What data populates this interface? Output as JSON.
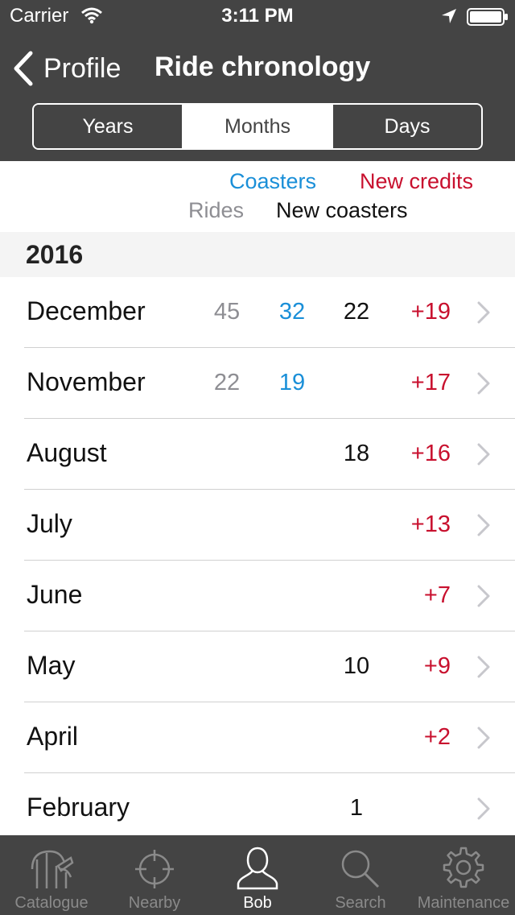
{
  "status_bar": {
    "carrier": "Carrier",
    "time": "3:11 PM"
  },
  "nav": {
    "back_label": "Profile",
    "title": "Ride chronology"
  },
  "segments": [
    {
      "label": "Years",
      "active": false
    },
    {
      "label": "Months",
      "active": true
    },
    {
      "label": "Days",
      "active": false
    }
  ],
  "legend": {
    "coasters": "Coasters",
    "new_credits": "New credits",
    "rides": "Rides",
    "new_coasters": "New coasters"
  },
  "section": {
    "year": "2016"
  },
  "rows": [
    {
      "month": "December",
      "rides": "45",
      "coasters": "32",
      "new_coasters": "22",
      "new_credits": "+19"
    },
    {
      "month": "November",
      "rides": "22",
      "coasters": "19",
      "new_coasters": "",
      "new_credits": "+17"
    },
    {
      "month": "August",
      "rides": "",
      "coasters": "",
      "new_coasters": "18",
      "new_credits": "+16"
    },
    {
      "month": "July",
      "rides": "",
      "coasters": "",
      "new_coasters": "",
      "new_credits": "+13"
    },
    {
      "month": "June",
      "rides": "",
      "coasters": "",
      "new_coasters": "",
      "new_credits": "+7"
    },
    {
      "month": "May",
      "rides": "",
      "coasters": "",
      "new_coasters": "10",
      "new_credits": "+9"
    },
    {
      "month": "April",
      "rides": "",
      "coasters": "",
      "new_coasters": "",
      "new_credits": "+2"
    },
    {
      "month": "February",
      "rides": "",
      "coasters": "",
      "new_coasters": "1",
      "new_credits": ""
    }
  ],
  "tabs": [
    {
      "label": "Catalogue",
      "icon": "coaster-icon",
      "active": false
    },
    {
      "label": "Nearby",
      "icon": "crosshair-icon",
      "active": false
    },
    {
      "label": "Bob",
      "icon": "person-icon",
      "active": true
    },
    {
      "label": "Search",
      "icon": "search-icon",
      "active": false
    },
    {
      "label": "Maintenance",
      "icon": "gear-icon",
      "active": false
    }
  ],
  "colors": {
    "bar_background": "#444444",
    "coasters_blue": "#1a8fd8",
    "credits_red": "#c8102e",
    "rides_gray": "#8e8e93"
  }
}
